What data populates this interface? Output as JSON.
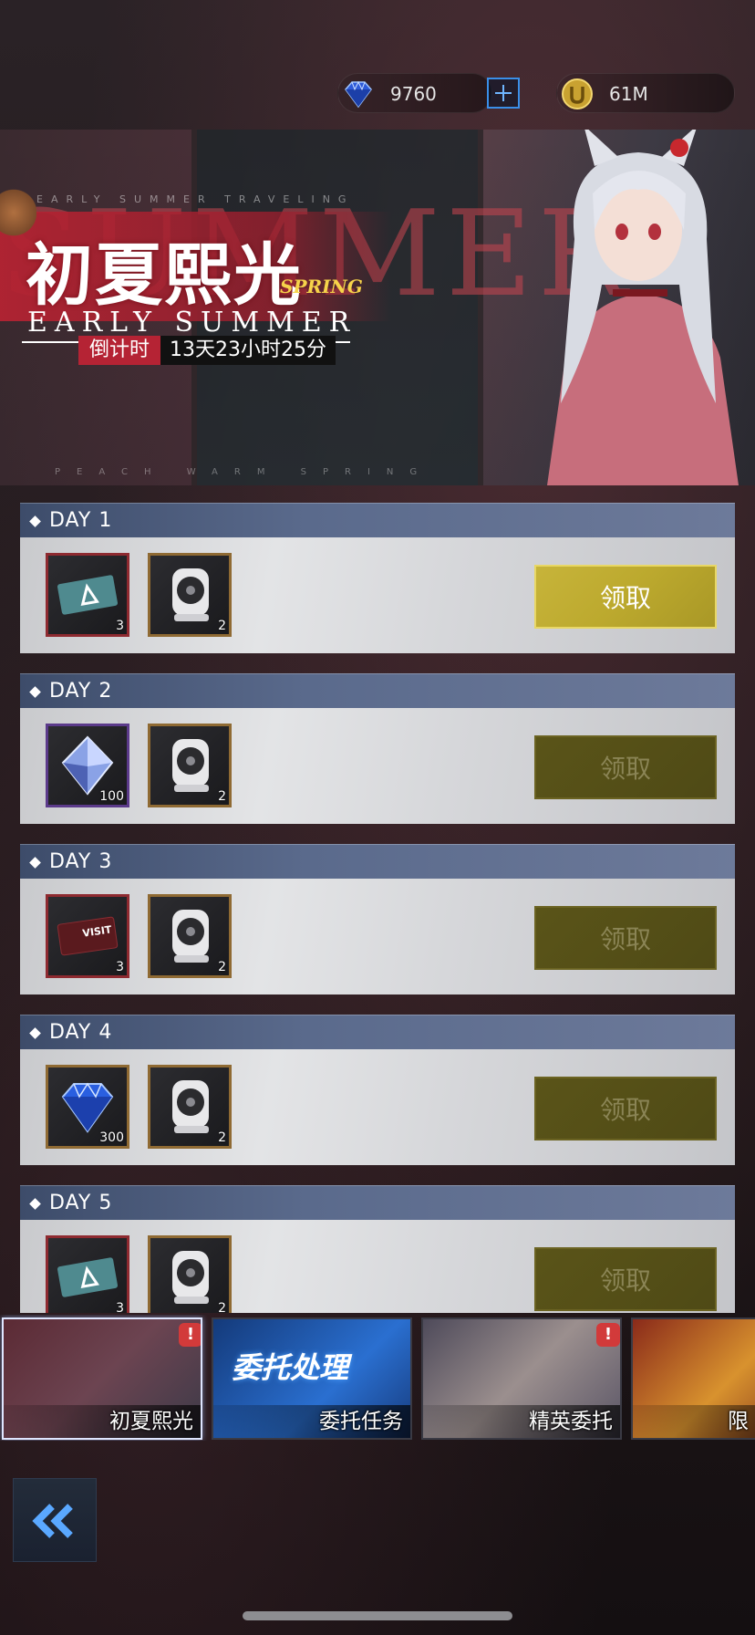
{
  "currency": {
    "gems": "9760",
    "coins": "61M"
  },
  "banner": {
    "title": "初夏熙光",
    "spring": "SPRING",
    "subtitle": "EARLY SUMMER",
    "countdown_label": "倒计时",
    "countdown_value": "13天23小时25分"
  },
  "days": [
    {
      "label": "DAY 1",
      "items": [
        {
          "count": "3",
          "icon": "ticket-icon",
          "frame": "red"
        },
        {
          "count": "2",
          "icon": "fan-device-icon",
          "frame": "gold"
        }
      ],
      "claim_label": "领取",
      "claim_state": "active"
    },
    {
      "label": "DAY 2",
      "items": [
        {
          "count": "100",
          "icon": "crystal-icon",
          "frame": "purple"
        },
        {
          "count": "2",
          "icon": "fan-device-icon",
          "frame": "gold"
        }
      ],
      "claim_label": "领取",
      "claim_state": "disabled"
    },
    {
      "label": "DAY 3",
      "items": [
        {
          "count": "3",
          "icon": "visit-card-icon",
          "frame": "red"
        },
        {
          "count": "2",
          "icon": "fan-device-icon",
          "frame": "gold"
        }
      ],
      "claim_label": "领取",
      "claim_state": "disabled"
    },
    {
      "label": "DAY 4",
      "items": [
        {
          "count": "300",
          "icon": "gem-icon",
          "frame": "gold"
        },
        {
          "count": "2",
          "icon": "fan-device-icon",
          "frame": "gold"
        }
      ],
      "claim_label": "领取",
      "claim_state": "disabled"
    },
    {
      "label": "DAY 5",
      "items": [
        {
          "count": "3",
          "icon": "ticket-icon",
          "frame": "red"
        },
        {
          "count": "2",
          "icon": "fan-device-icon",
          "frame": "gold"
        }
      ],
      "claim_label": "领取",
      "claim_state": "disabled"
    }
  ],
  "tabs": [
    {
      "label": "初夏熙光",
      "alert": "!",
      "active": true
    },
    {
      "label": "委托任务",
      "overlay": "委托处理",
      "active": false
    },
    {
      "label": "精英委托",
      "alert": "!",
      "active": false
    },
    {
      "label": "限",
      "active": false
    }
  ],
  "colors": {
    "accent_gold": "#c7b43a",
    "header_blue": "#5a6a8c",
    "banner_red": "#b52334",
    "alert_red": "#d23a3a",
    "back_arrow": "#5aa8ff"
  }
}
